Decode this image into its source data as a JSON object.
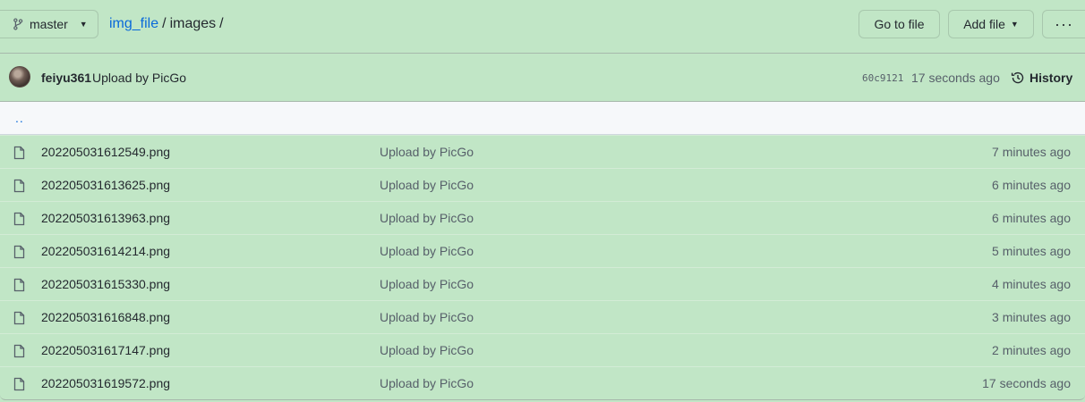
{
  "branch": {
    "name": "master"
  },
  "breadcrumb": {
    "repo": "img_file",
    "sep1": "/",
    "folder": "images",
    "sep2": "/"
  },
  "actions": {
    "go_to_file": "Go to file",
    "add_file": "Add file",
    "more": "···"
  },
  "latest_commit": {
    "author": "feiyu361",
    "message": "Upload by PicGo",
    "sha": "60c9121",
    "time": "17 seconds ago",
    "history_label": "History"
  },
  "parent_dir": "..",
  "files": [
    {
      "name": "202205031612549.png",
      "message": "Upload by PicGo",
      "time": "7 minutes ago"
    },
    {
      "name": "202205031613625.png",
      "message": "Upload by PicGo",
      "time": "6 minutes ago"
    },
    {
      "name": "202205031613963.png",
      "message": "Upload by PicGo",
      "time": "6 minutes ago"
    },
    {
      "name": "202205031614214.png",
      "message": "Upload by PicGo",
      "time": "5 minutes ago"
    },
    {
      "name": "202205031615330.png",
      "message": "Upload by PicGo",
      "time": "4 minutes ago"
    },
    {
      "name": "202205031616848.png",
      "message": "Upload by PicGo",
      "time": "3 minutes ago"
    },
    {
      "name": "202205031617147.png",
      "message": "Upload by PicGo",
      "time": "2 minutes ago"
    },
    {
      "name": "202205031619572.png",
      "message": "Upload by PicGo",
      "time": "17 seconds ago"
    }
  ],
  "colors": {
    "background": "#c1e6c6",
    "link": "#0969da",
    "muted": "#57606a",
    "parent_row": "#f6f8fa"
  }
}
